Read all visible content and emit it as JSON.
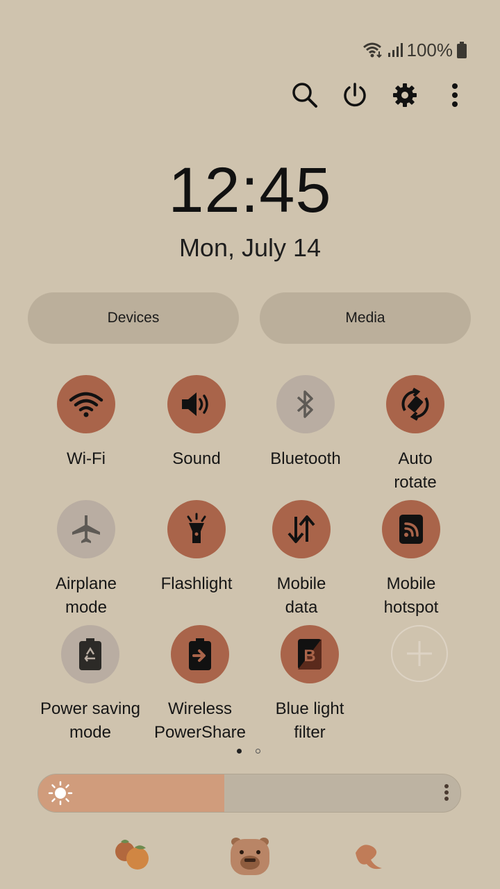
{
  "status_bar": {
    "battery_percent": "100%",
    "icons": [
      "wifi-icon",
      "signal-icon",
      "battery-icon"
    ]
  },
  "top_actions": [
    "search-icon",
    "power-icon",
    "settings-gear-icon",
    "more-vertical-icon"
  ],
  "clock": {
    "time": "12:45",
    "date": "Mon, July 14"
  },
  "pills": {
    "devices": "Devices",
    "media": "Media"
  },
  "tiles": [
    {
      "label": "Wi-Fi",
      "icon": "wifi-icon",
      "state": "on"
    },
    {
      "label": "Sound",
      "icon": "sound-icon",
      "state": "on"
    },
    {
      "label": "Bluetooth",
      "icon": "bluetooth-icon",
      "state": "off"
    },
    {
      "label": "Auto\nrotate",
      "icon": "auto-rotate-icon",
      "state": "on"
    },
    {
      "label": "Airplane\nmode",
      "icon": "airplane-icon",
      "state": "off"
    },
    {
      "label": "Flashlight",
      "icon": "flashlight-icon",
      "state": "on"
    },
    {
      "label": "Mobile\ndata",
      "icon": "mobile-data-icon",
      "state": "on"
    },
    {
      "label": "Mobile\nhotspot",
      "icon": "hotspot-icon",
      "state": "on"
    },
    {
      "label": "Power saving\nmode",
      "icon": "power-saving-icon",
      "state": "off"
    },
    {
      "label": "Wireless\nPowerShare",
      "icon": "wireless-powershare-icon",
      "state": "on"
    },
    {
      "label": "Blue light\nfilter",
      "icon": "blue-light-filter-icon",
      "state": "on"
    },
    {
      "label": "",
      "icon": "add-icon",
      "state": "add"
    }
  ],
  "page_indicator": {
    "current": 1,
    "total": 2
  },
  "brightness": {
    "level": 0.44
  },
  "colors": {
    "background": "#cfc3ae",
    "tile_on": "#a9644a",
    "tile_off": "#b9ada2",
    "brightness_fill": "#d09c7c"
  },
  "decorations": [
    "oranges-sticker",
    "capybara-sticker",
    "leaf-sticker"
  ]
}
